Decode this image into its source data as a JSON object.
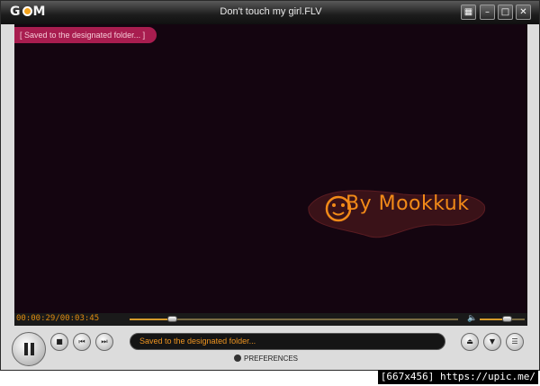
{
  "window": {
    "app_logo": "GOM",
    "title": "Don't touch my girl.FLV",
    "controls": [
      "skin-icon",
      "minimize-icon",
      "maximize-icon",
      "close-icon"
    ]
  },
  "video": {
    "osd_message": "[ Saved to the designated folder... ]",
    "watermark_text": "By Mookkuk"
  },
  "playback": {
    "time_display": "00:00:29/00:03:45",
    "progress_fraction": 0.129,
    "volume_fraction": 0.6
  },
  "controls": {
    "main_button_icon": "pause-icon",
    "stop_icon": "stop-icon",
    "prev_icon": "prev-icon",
    "next_icon": "next-icon",
    "status_text": "Saved to the designated folder...",
    "right_icons": [
      "eject-icon",
      "chevron-down-icon",
      "menu-icon"
    ],
    "preferences_label": "PREFERENCES"
  },
  "footer": {
    "watermark": "[667x456] https://upic.me/"
  },
  "colors": {
    "accent": "#e08a10",
    "osd_bg": "#a81d4f",
    "video_bg": "#140510"
  }
}
